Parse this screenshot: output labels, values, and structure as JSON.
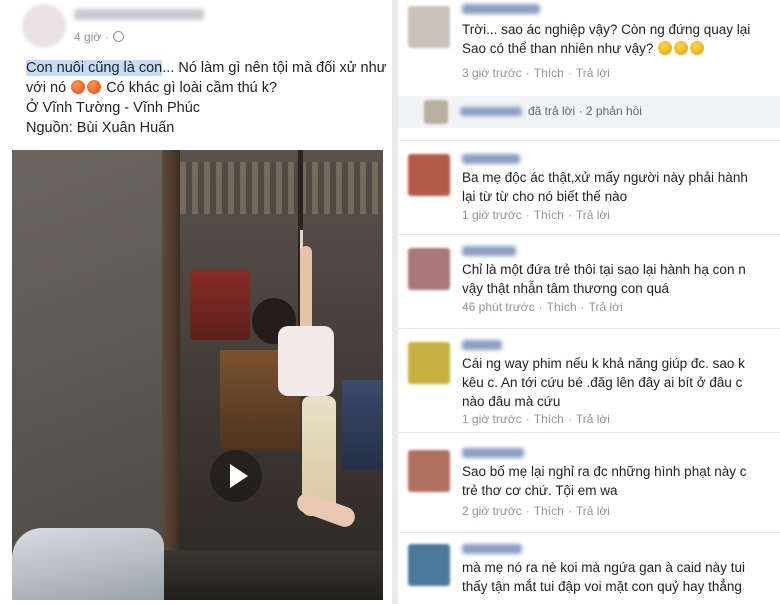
{
  "post": {
    "time": "4 giờ",
    "text_lines": [
      {
        "highlight": "Con nuôi cũng là con",
        "rest": "... Nó làm gì nên tội mà đối xử như"
      },
      {
        "before": "với nó ",
        "after": " Có khác gì loài cầm thú k?"
      },
      {
        "text": "Ở Vĩnh Tường - Vĩnh Phúc"
      },
      {
        "text": "Nguồn: Bùi Xuân Huấn"
      }
    ]
  },
  "comments": [
    {
      "lines": [
        "Trời... sao ác nghiệp vậy? Còn ng đứng quay lại",
        "Sao có thể than nhiên như vậy?"
      ],
      "time": "3 giờ trước",
      "like": "Thích",
      "reply": "Trả lời"
    },
    {
      "lines": [
        "Ba mẹ độc ác thật,xử mấy người này phải hành",
        "lại từ từ cho nó biết thế nào"
      ],
      "time": "1 giờ trước",
      "like": "Thích",
      "reply": "Trả lời"
    },
    {
      "lines": [
        "Chỉ là một đứa trẻ thôi tại sao lại hành hạ con n",
        "vậy thật nhẫn tâm thương con quá"
      ],
      "time": "46 phút trước",
      "like": "Thích",
      "reply": "Trả lời"
    },
    {
      "lines": [
        "Cái ng way phim nếu k khả năng giúp đc. sao k",
        "kêu c. An tới cứu bé .đăg lên đây ai bít ở đâu c",
        "nào đâu mà cứu"
      ],
      "time": "1 giờ trước",
      "like": "Thích",
      "reply": "Trả lời"
    },
    {
      "lines": [
        "Sao bố mẹ lại nghỉ ra đc những hình phạt này c",
        "trẻ thơ cơ chứ. Tội em wa"
      ],
      "time": "2 giờ trước",
      "like": "Thích",
      "reply": "Trả lời"
    },
    {
      "lines": [
        "mà mẹ nó ra nè koi mà ngứa gan à caid này tui",
        "thấy tận mắt tui đập voi mặt con quỷ hay thẳng"
      ],
      "time": "",
      "like": "",
      "reply": ""
    }
  ],
  "reply_summary": {
    "replied": "đã trả lời",
    "dot": "·",
    "count": "2 phản hồi"
  },
  "icons": {
    "globe": "globe-icon",
    "play": "play-icon",
    "angry_emoji": "angry-emoji-icon",
    "emoji": "emoji-icon"
  }
}
